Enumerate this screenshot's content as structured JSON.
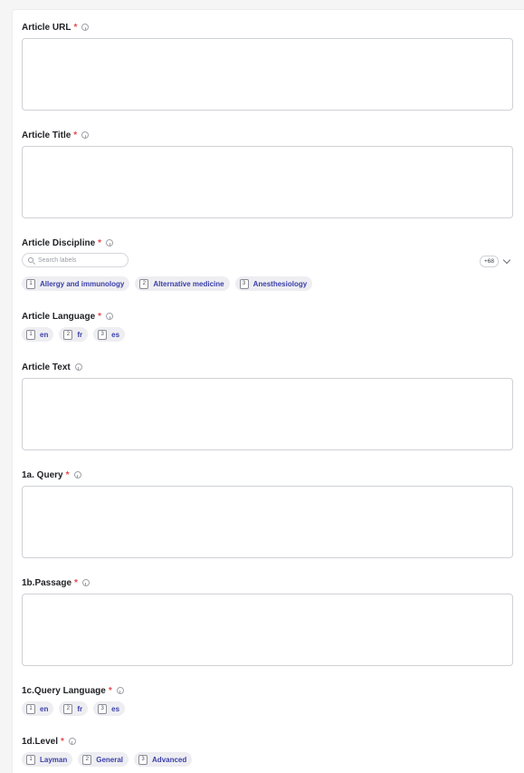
{
  "fields": {
    "article_url": {
      "label": "Article URL",
      "required": "*"
    },
    "article_title": {
      "label": "Article Title",
      "required": "*"
    },
    "article_discipline": {
      "label": "Article Discipline",
      "required": "*",
      "search_placeholder": "Search labels",
      "more_count": "+68",
      "options": [
        {
          "key": "1",
          "label": "Allergy and immunology"
        },
        {
          "key": "2",
          "label": "Alternative medicine"
        },
        {
          "key": "3",
          "label": "Anesthesiology"
        }
      ]
    },
    "article_language": {
      "label": "Article Language",
      "required": "*",
      "options": [
        {
          "key": "1",
          "label": "en"
        },
        {
          "key": "2",
          "label": "fr"
        },
        {
          "key": "3",
          "label": "es"
        }
      ]
    },
    "article_text": {
      "label": "Article Text"
    },
    "query": {
      "label": "1a. Query",
      "required": "*"
    },
    "passage": {
      "label": "1b.Passage",
      "required": "*"
    },
    "query_language": {
      "label": "1c.Query Language",
      "required": "*",
      "options": [
        {
          "key": "1",
          "label": "en"
        },
        {
          "key": "2",
          "label": "fr"
        },
        {
          "key": "3",
          "label": "es"
        }
      ]
    },
    "level": {
      "label": "1d.Level",
      "required": "*",
      "options": [
        {
          "key": "1",
          "label": "Layman"
        },
        {
          "key": "2",
          "label": "General"
        },
        {
          "key": "3",
          "label": "Advanced"
        }
      ]
    }
  },
  "colors": {
    "required": "#e5484d",
    "chip_text": "#3b3fa8",
    "chip_bg": "#eeeef2"
  }
}
